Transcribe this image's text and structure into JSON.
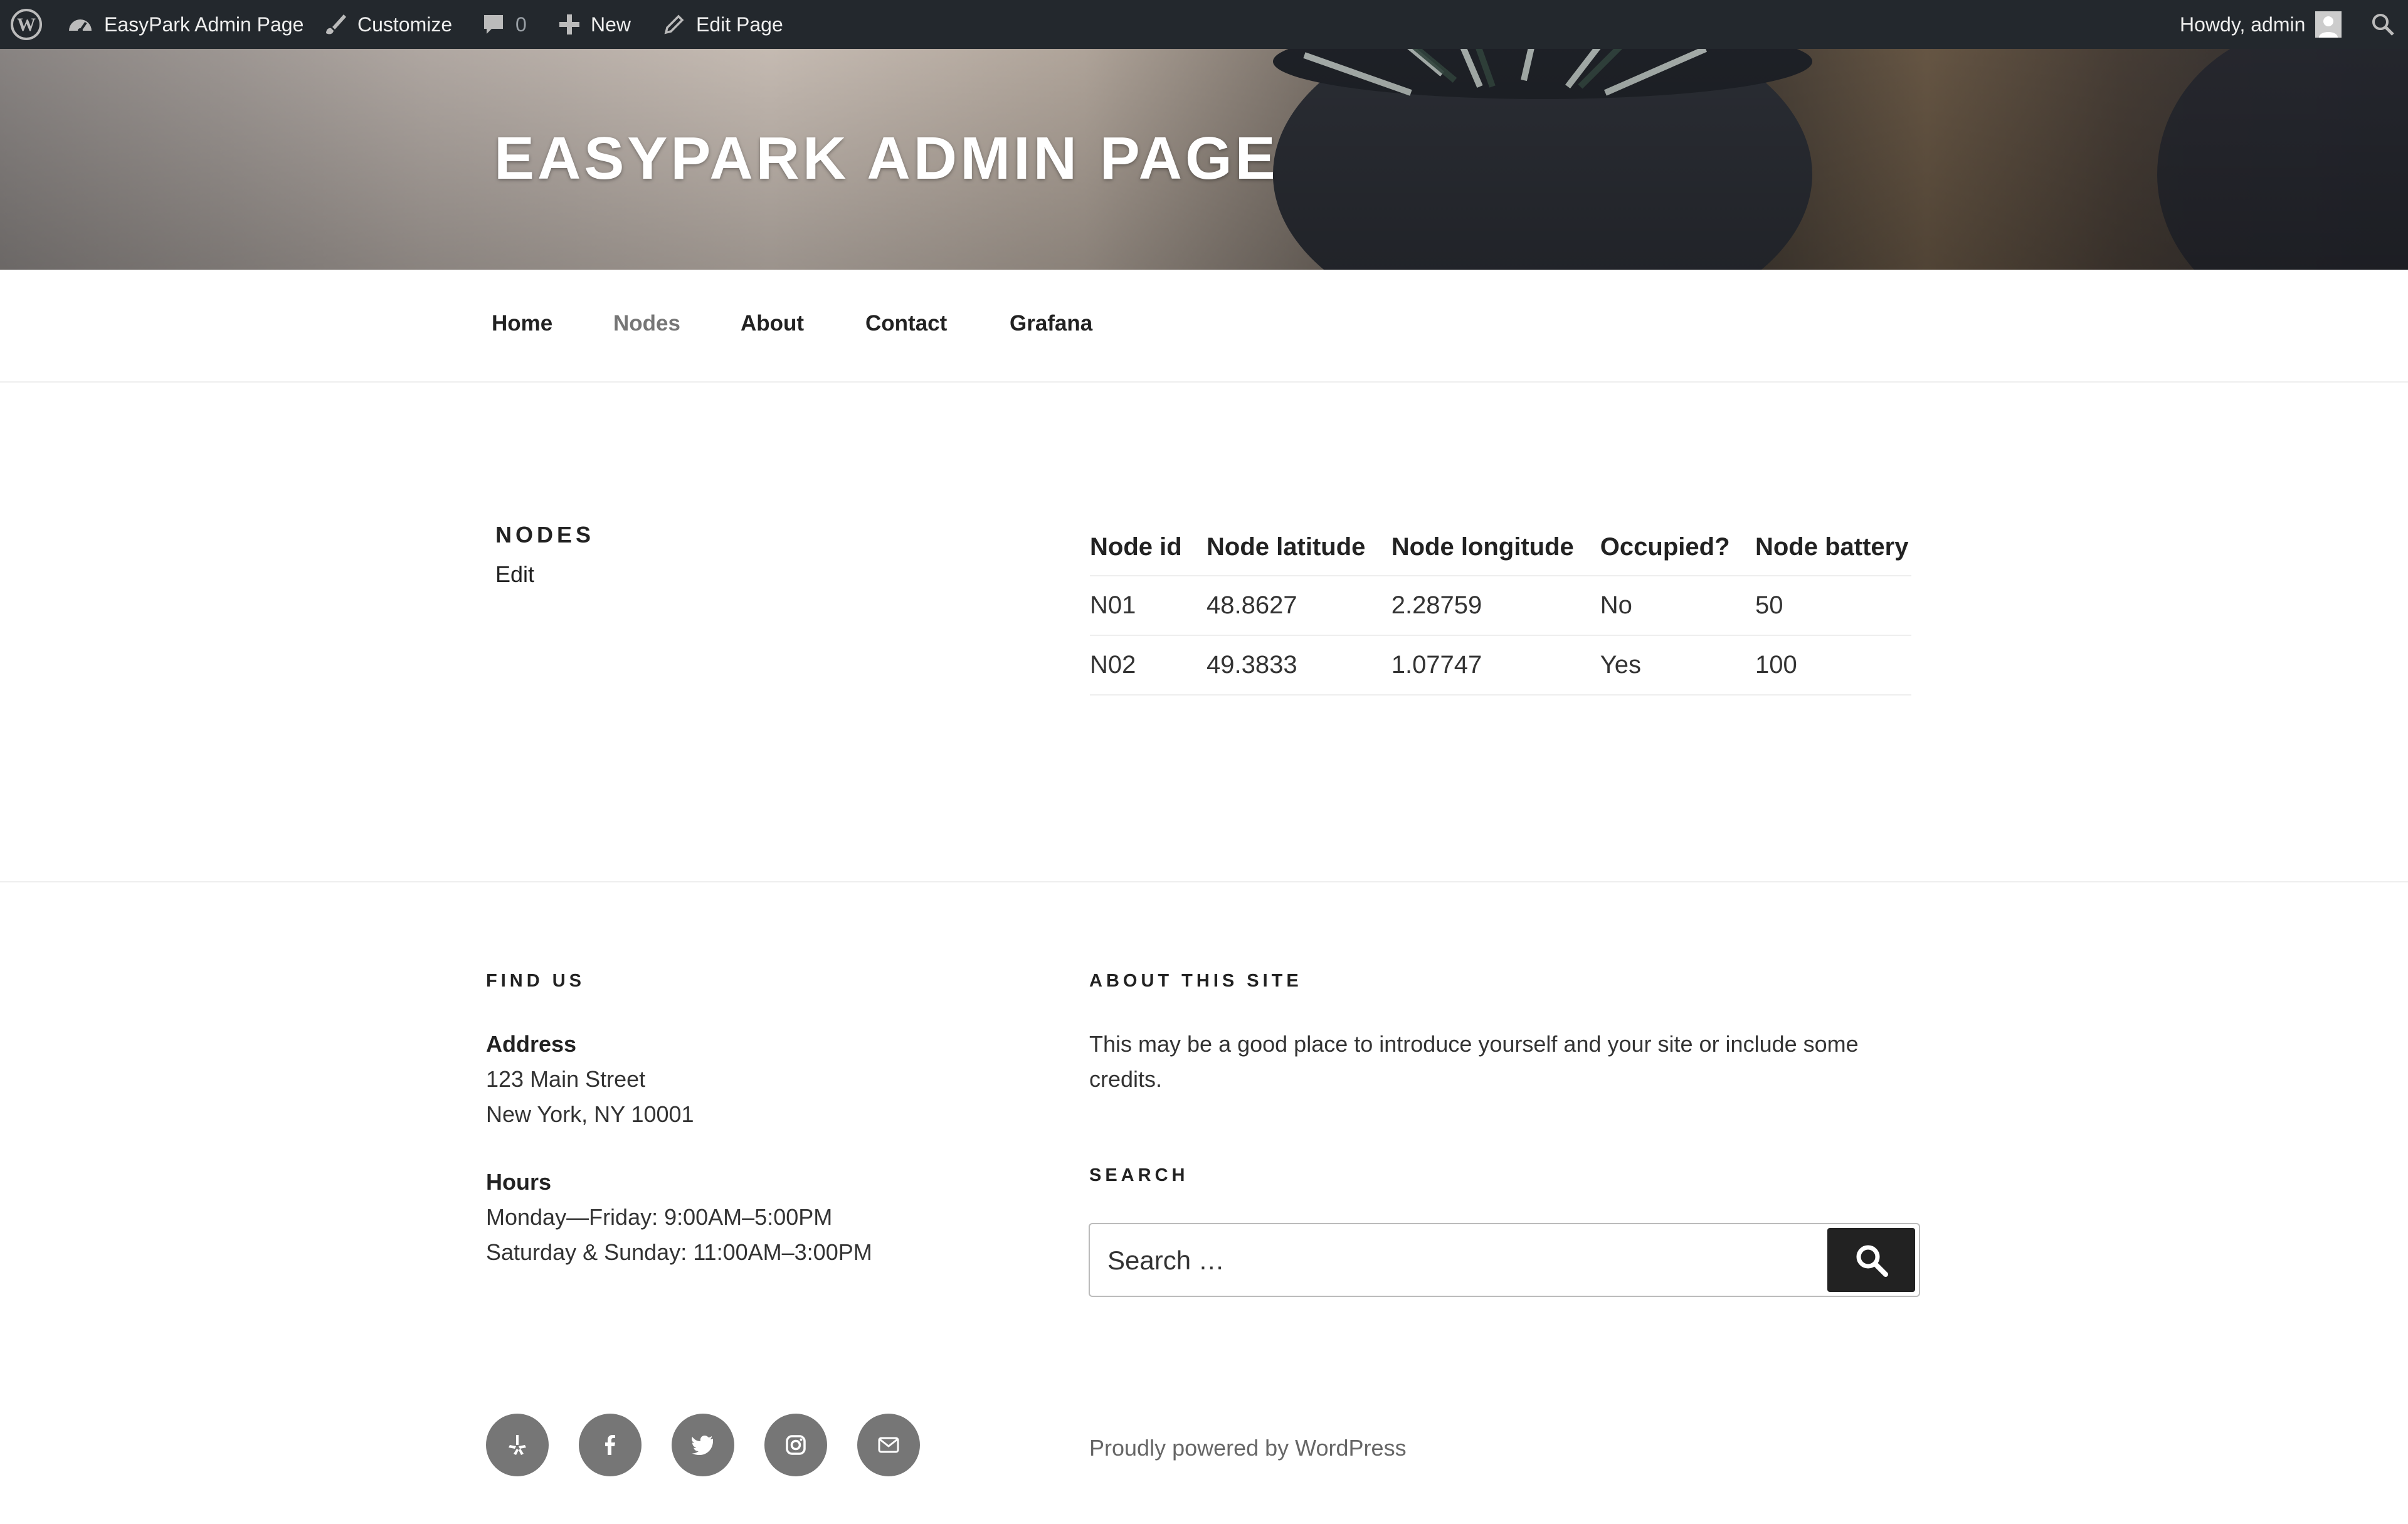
{
  "adminbar": {
    "site_name": "EasyPark Admin Page",
    "customize": "Customize",
    "comments_count": "0",
    "new": "New",
    "edit_page": "Edit Page",
    "howdy": "Howdy, admin"
  },
  "header": {
    "site_title": "EASYPARK ADMIN PAGE"
  },
  "nav": {
    "items": [
      {
        "label": "Home"
      },
      {
        "label": "Nodes",
        "current": true
      },
      {
        "label": "About"
      },
      {
        "label": "Contact"
      },
      {
        "label": "Grafana"
      }
    ]
  },
  "page": {
    "title": "NODES",
    "edit": "Edit",
    "table": {
      "headers": [
        "Node id",
        "Node latitude",
        "Node longitude",
        "Occupied?",
        "Node battery"
      ],
      "rows": [
        [
          "N01",
          "48.8627",
          "2.28759",
          "No",
          "50"
        ],
        [
          "N02",
          "49.3833",
          "1.07747",
          "Yes",
          "100"
        ]
      ]
    }
  },
  "footer": {
    "find_us": {
      "title": "FIND US",
      "address_label": "Address",
      "address_line1": "123 Main Street",
      "address_line2": "New York, NY 10001",
      "hours_label": "Hours",
      "hours_line1": "Monday—Friday: 9:00AM–5:00PM",
      "hours_line2": "Saturday & Sunday: 11:00AM–3:00PM"
    },
    "about": {
      "title": "ABOUT THIS SITE",
      "line1": "This may be a good place to introduce yourself and your site or include some",
      "line2": "credits."
    },
    "search": {
      "title": "SEARCH",
      "placeholder": "Search …"
    },
    "social_icons": [
      "yelp-icon",
      "facebook-icon",
      "twitter-icon",
      "instagram-icon",
      "email-icon"
    ],
    "powered_by": "Proudly powered by WordPress"
  },
  "colors": {
    "adminbar_bg": "#23282d",
    "text_dark": "#222222",
    "nav_current": "#767676",
    "social_bg": "#767676"
  }
}
